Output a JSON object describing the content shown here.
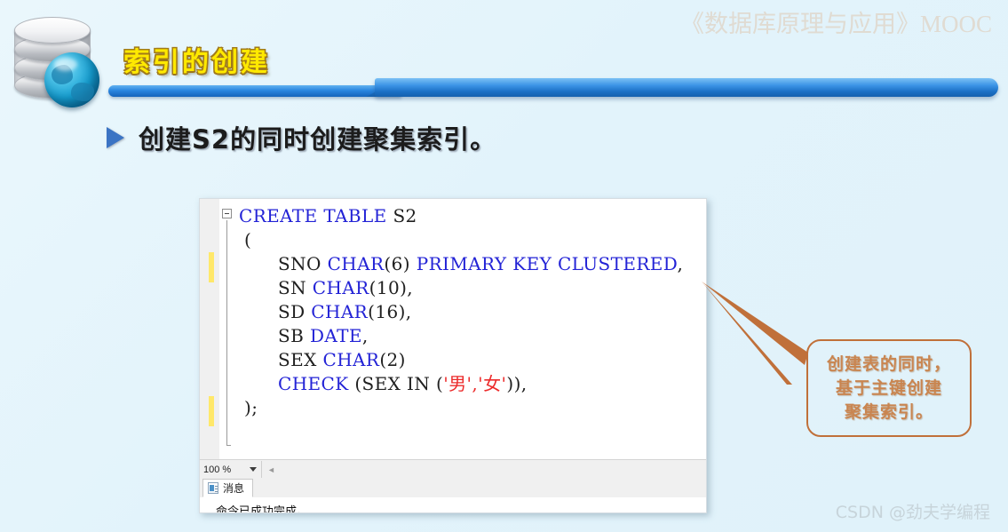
{
  "watermarks": {
    "course": "《数据库原理与应用》MOOC",
    "csdn": "CSDN @劲夫学编程"
  },
  "header": {
    "title": "索引的创建",
    "icon": "database-globe-icon"
  },
  "bullet": {
    "marker": "triangle-bullet-icon",
    "text": "创建S2的同时创建聚集索引。"
  },
  "code_panel": {
    "fold_marker": "collapse-minus-icon",
    "lines": [
      {
        "indent": 0,
        "tokens": [
          {
            "t": "CREATE TABLE ",
            "c": "kw"
          },
          {
            "t": "S2",
            "c": "pl"
          }
        ]
      },
      {
        "indent": 1,
        "tokens": [
          {
            "t": "(",
            "c": "pl"
          }
        ]
      },
      {
        "indent": 2,
        "tokens": [
          {
            "t": "SNO ",
            "c": "pl"
          },
          {
            "t": "CHAR",
            "c": "kw"
          },
          {
            "t": "(6) ",
            "c": "pl"
          },
          {
            "t": "PRIMARY KEY CLUSTERED",
            "c": "kw"
          },
          {
            "t": ",",
            "c": "pl"
          }
        ]
      },
      {
        "indent": 2,
        "tokens": [
          {
            "t": "SN ",
            "c": "pl"
          },
          {
            "t": "CHAR",
            "c": "kw"
          },
          {
            "t": "(10),",
            "c": "pl"
          }
        ]
      },
      {
        "indent": 2,
        "tokens": [
          {
            "t": "SD ",
            "c": "pl"
          },
          {
            "t": "CHAR",
            "c": "kw"
          },
          {
            "t": "(16),",
            "c": "pl"
          }
        ]
      },
      {
        "indent": 2,
        "tokens": [
          {
            "t": "SB ",
            "c": "pl"
          },
          {
            "t": "DATE",
            "c": "kw"
          },
          {
            "t": ",",
            "c": "pl"
          }
        ]
      },
      {
        "indent": 2,
        "tokens": [
          {
            "t": "SEX ",
            "c": "pl"
          },
          {
            "t": "CHAR",
            "c": "kw"
          },
          {
            "t": "(2)",
            "c": "pl"
          }
        ]
      },
      {
        "indent": 2,
        "tokens": [
          {
            "t": "CHECK",
            "c": "kw"
          },
          {
            "t": " (SEX IN (",
            "c": "pl"
          },
          {
            "t": "'男','女'",
            "c": "str"
          },
          {
            "t": ")),",
            "c": "pl"
          }
        ]
      },
      {
        "indent": 1,
        "tokens": [
          {
            "t": ");",
            "c": "pl"
          }
        ]
      }
    ],
    "zoom_level": "100 %",
    "zoom_caret": "chevron-down-icon",
    "results_tab": "消息",
    "results_tab_icon": "messages-icon",
    "message_text": "命令已成功完成。"
  },
  "callout": {
    "line1": "创建表的同时，",
    "line2": "基于主键创建",
    "line3": "聚集索引。",
    "border_color": "#c0703a",
    "text_color": "#c98550"
  },
  "colors": {
    "background": "#e4f4fb",
    "title_yellow": "#ffe900",
    "divider_blue": "#2a86e0",
    "keyword_blue": "#2323d6",
    "string_red": "#ec2b2b"
  }
}
